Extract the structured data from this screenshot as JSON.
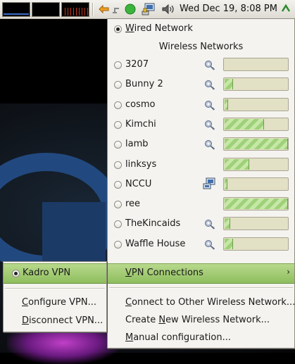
{
  "panel": {
    "clock": "Wed Dec 19,  8:08 PM",
    "tray_icons": [
      "mail-notify-icon",
      "network-connected-icon",
      "network-manager-icon",
      "volume-icon",
      "power-icon"
    ]
  },
  "network_menu": {
    "wired": {
      "label_pre": "",
      "label_u": "W",
      "label_post": "ired Network",
      "selected": true
    },
    "wireless_header": "Wireless Networks",
    "networks": [
      {
        "name": "3207",
        "secure": true,
        "adhoc": false,
        "signal": 0
      },
      {
        "name": "Bunny 2",
        "secure": true,
        "adhoc": false,
        "signal": 0.12
      },
      {
        "name": "cosmo",
        "secure": true,
        "adhoc": false,
        "signal": 0.04
      },
      {
        "name": "Kimchi",
        "secure": true,
        "adhoc": false,
        "signal": 0.62
      },
      {
        "name": "lamb",
        "secure": true,
        "adhoc": false,
        "signal": 1.0
      },
      {
        "name": "linksys",
        "secure": false,
        "adhoc": false,
        "signal": 0.38
      },
      {
        "name": "NCCU",
        "secure": false,
        "adhoc": true,
        "signal": 0.03
      },
      {
        "name": "ree",
        "secure": false,
        "adhoc": false,
        "signal": 1.0
      },
      {
        "name": "TheKincaids",
        "secure": true,
        "adhoc": false,
        "signal": 0.08
      },
      {
        "name": "Waffle House",
        "secure": true,
        "adhoc": false,
        "signal": 0.12
      }
    ],
    "vpn": {
      "pre": "",
      "u": "V",
      "post": "PN Connections",
      "arrow": "›"
    },
    "connect_other": {
      "pre": "",
      "u": "C",
      "post": "onnect to Other Wireless Network..."
    },
    "create_new": {
      "pre": "Create ",
      "u": "N",
      "post": "ew Wireless Network..."
    },
    "manual": {
      "pre": "",
      "u": "M",
      "post": "anual configuration..."
    }
  },
  "vpn_menu": {
    "kadro": {
      "label": "Kadro VPN",
      "selected": true
    },
    "configure": {
      "pre": "",
      "u": "C",
      "post": "onfigure VPN..."
    },
    "disconnect": {
      "pre": "",
      "u": "D",
      "post": "isconnect VPN..."
    }
  },
  "colors": {
    "highlight": "#9cc96a",
    "signal_fill": "#a9d882",
    "menu_bg": "#f4f3ef"
  }
}
